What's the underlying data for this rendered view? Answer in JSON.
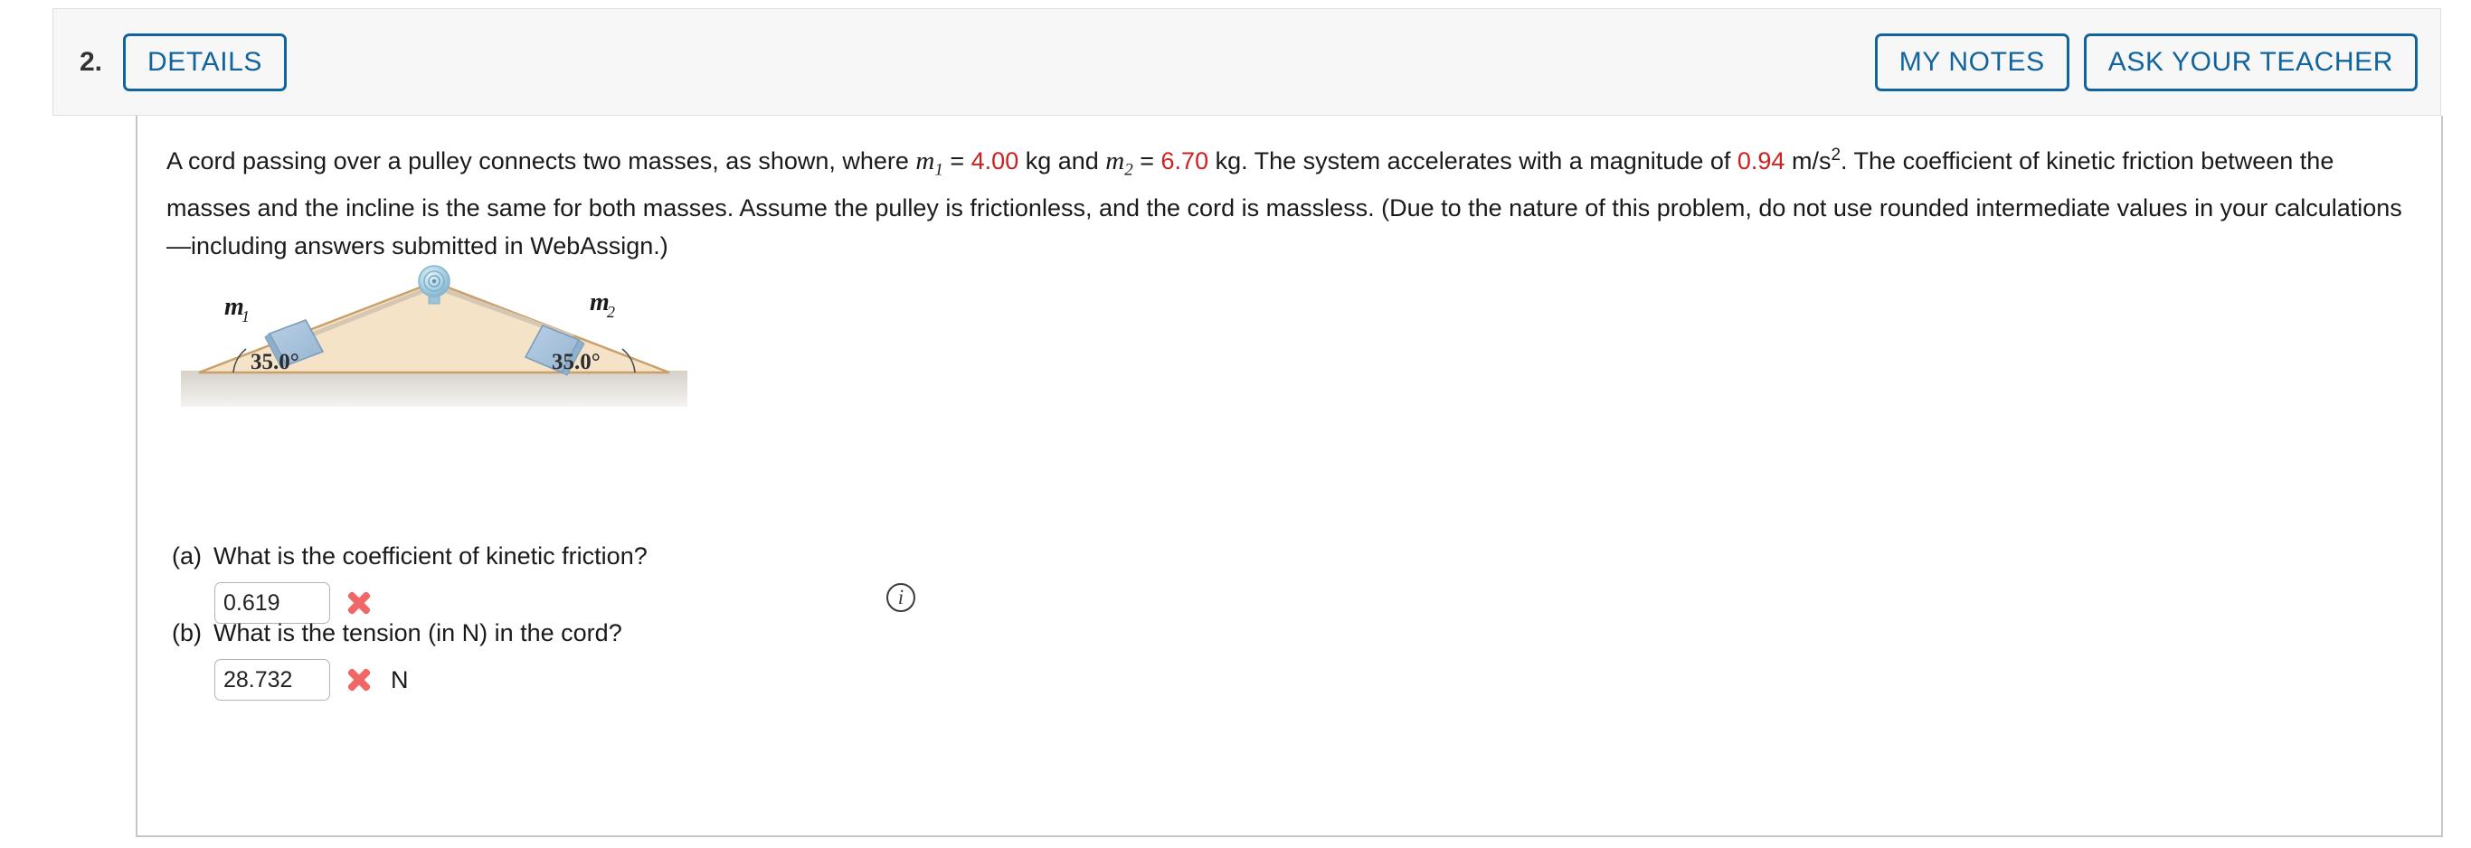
{
  "header": {
    "question_number": "2.",
    "details_label": "DETAILS",
    "my_notes_label": "MY NOTES",
    "ask_teacher_label": "ASK YOUR TEACHER",
    "accent_color": "#12659c",
    "background_color": "#f7f7f7"
  },
  "problem": {
    "text_part_1": "A cord passing over a pulley connects two masses, as shown, where ",
    "m1_symbol": "m",
    "m1_sub": "1",
    "eq_1": " = ",
    "m1_value": "4.00",
    "unit_kg_1": " kg and ",
    "m2_symbol": "m",
    "m2_sub": "2",
    "eq_2": " = ",
    "m2_value": "6.70",
    "unit_kg_2": " kg. The system accelerates with a magnitude of ",
    "accel_value": "0.94",
    "accel_unit": " m/s",
    "accel_exponent": "2",
    "text_part_2": ". The coefficient of kinetic friction between the masses and the incline is the same for both masses. Assume the pulley is frictionless, and the cord is massless. (Due to the nature of this problem, do not use rounded intermediate values in your calculations—including answers submitted in WebAssign.)",
    "red_value_color": "#d02020"
  },
  "figure": {
    "mass1_label": "m",
    "mass1_sub": "1",
    "mass2_label": "m",
    "mass2_sub": "2",
    "angle_left": "35.0°",
    "angle_right": "35.0°",
    "info_icon_glyph": "i",
    "incline_fill": "#f5e3c8",
    "incline_stroke": "#c9a06a",
    "block_fill": "#a9c4dd",
    "cord_color": "#d6c7b4",
    "ground_top": "#d8d2ca",
    "ground_bottom": "#f2f1ef",
    "pulley_color": "#9dc3d8"
  },
  "parts": [
    {
      "letter": "(a)",
      "question": "What is the coefficient of kinetic friction?",
      "answer_value": "0.619",
      "status": "incorrect",
      "unit": ""
    },
    {
      "letter": "(b)",
      "question": "What is the tension (in N) in the cord?",
      "answer_value": "28.732",
      "status": "incorrect",
      "unit": "N"
    }
  ],
  "status_colors": {
    "incorrect": "#f06767"
  }
}
